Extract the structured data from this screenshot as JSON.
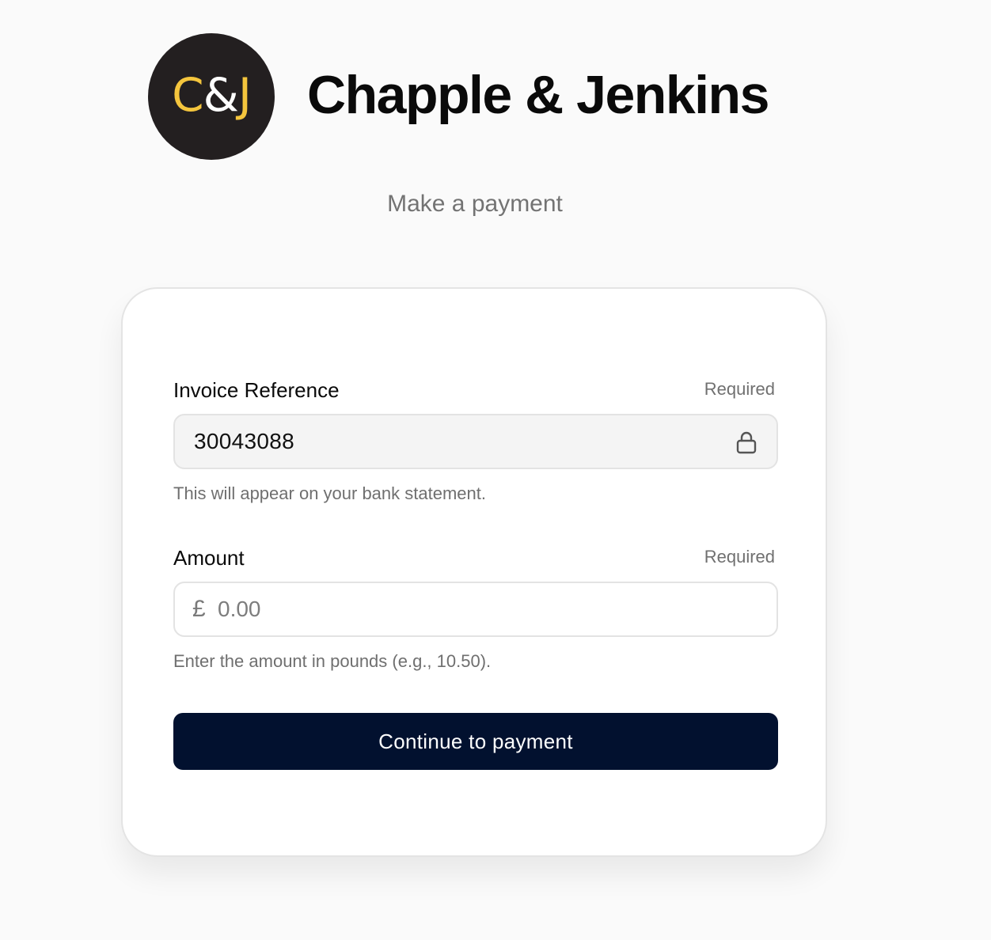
{
  "brand": {
    "logo_c": "C",
    "logo_amp": "&",
    "logo_j": "J",
    "name": "Chapple & Jenkins",
    "logo_background": "#231f20",
    "logo_accent": "#f4c53d"
  },
  "page": {
    "subtitle": "Make a payment"
  },
  "form": {
    "invoice": {
      "label": "Invoice Reference",
      "required": "Required",
      "value": "30043088",
      "icon": "lock-icon",
      "help": "This will appear on your bank statement."
    },
    "amount": {
      "label": "Amount",
      "required": "Required",
      "currency_symbol": "£",
      "placeholder": "0.00",
      "help": "Enter the amount in pounds (e.g., 10.50)."
    },
    "submit_label": "Continue to payment",
    "submit_color": "#02112f"
  }
}
